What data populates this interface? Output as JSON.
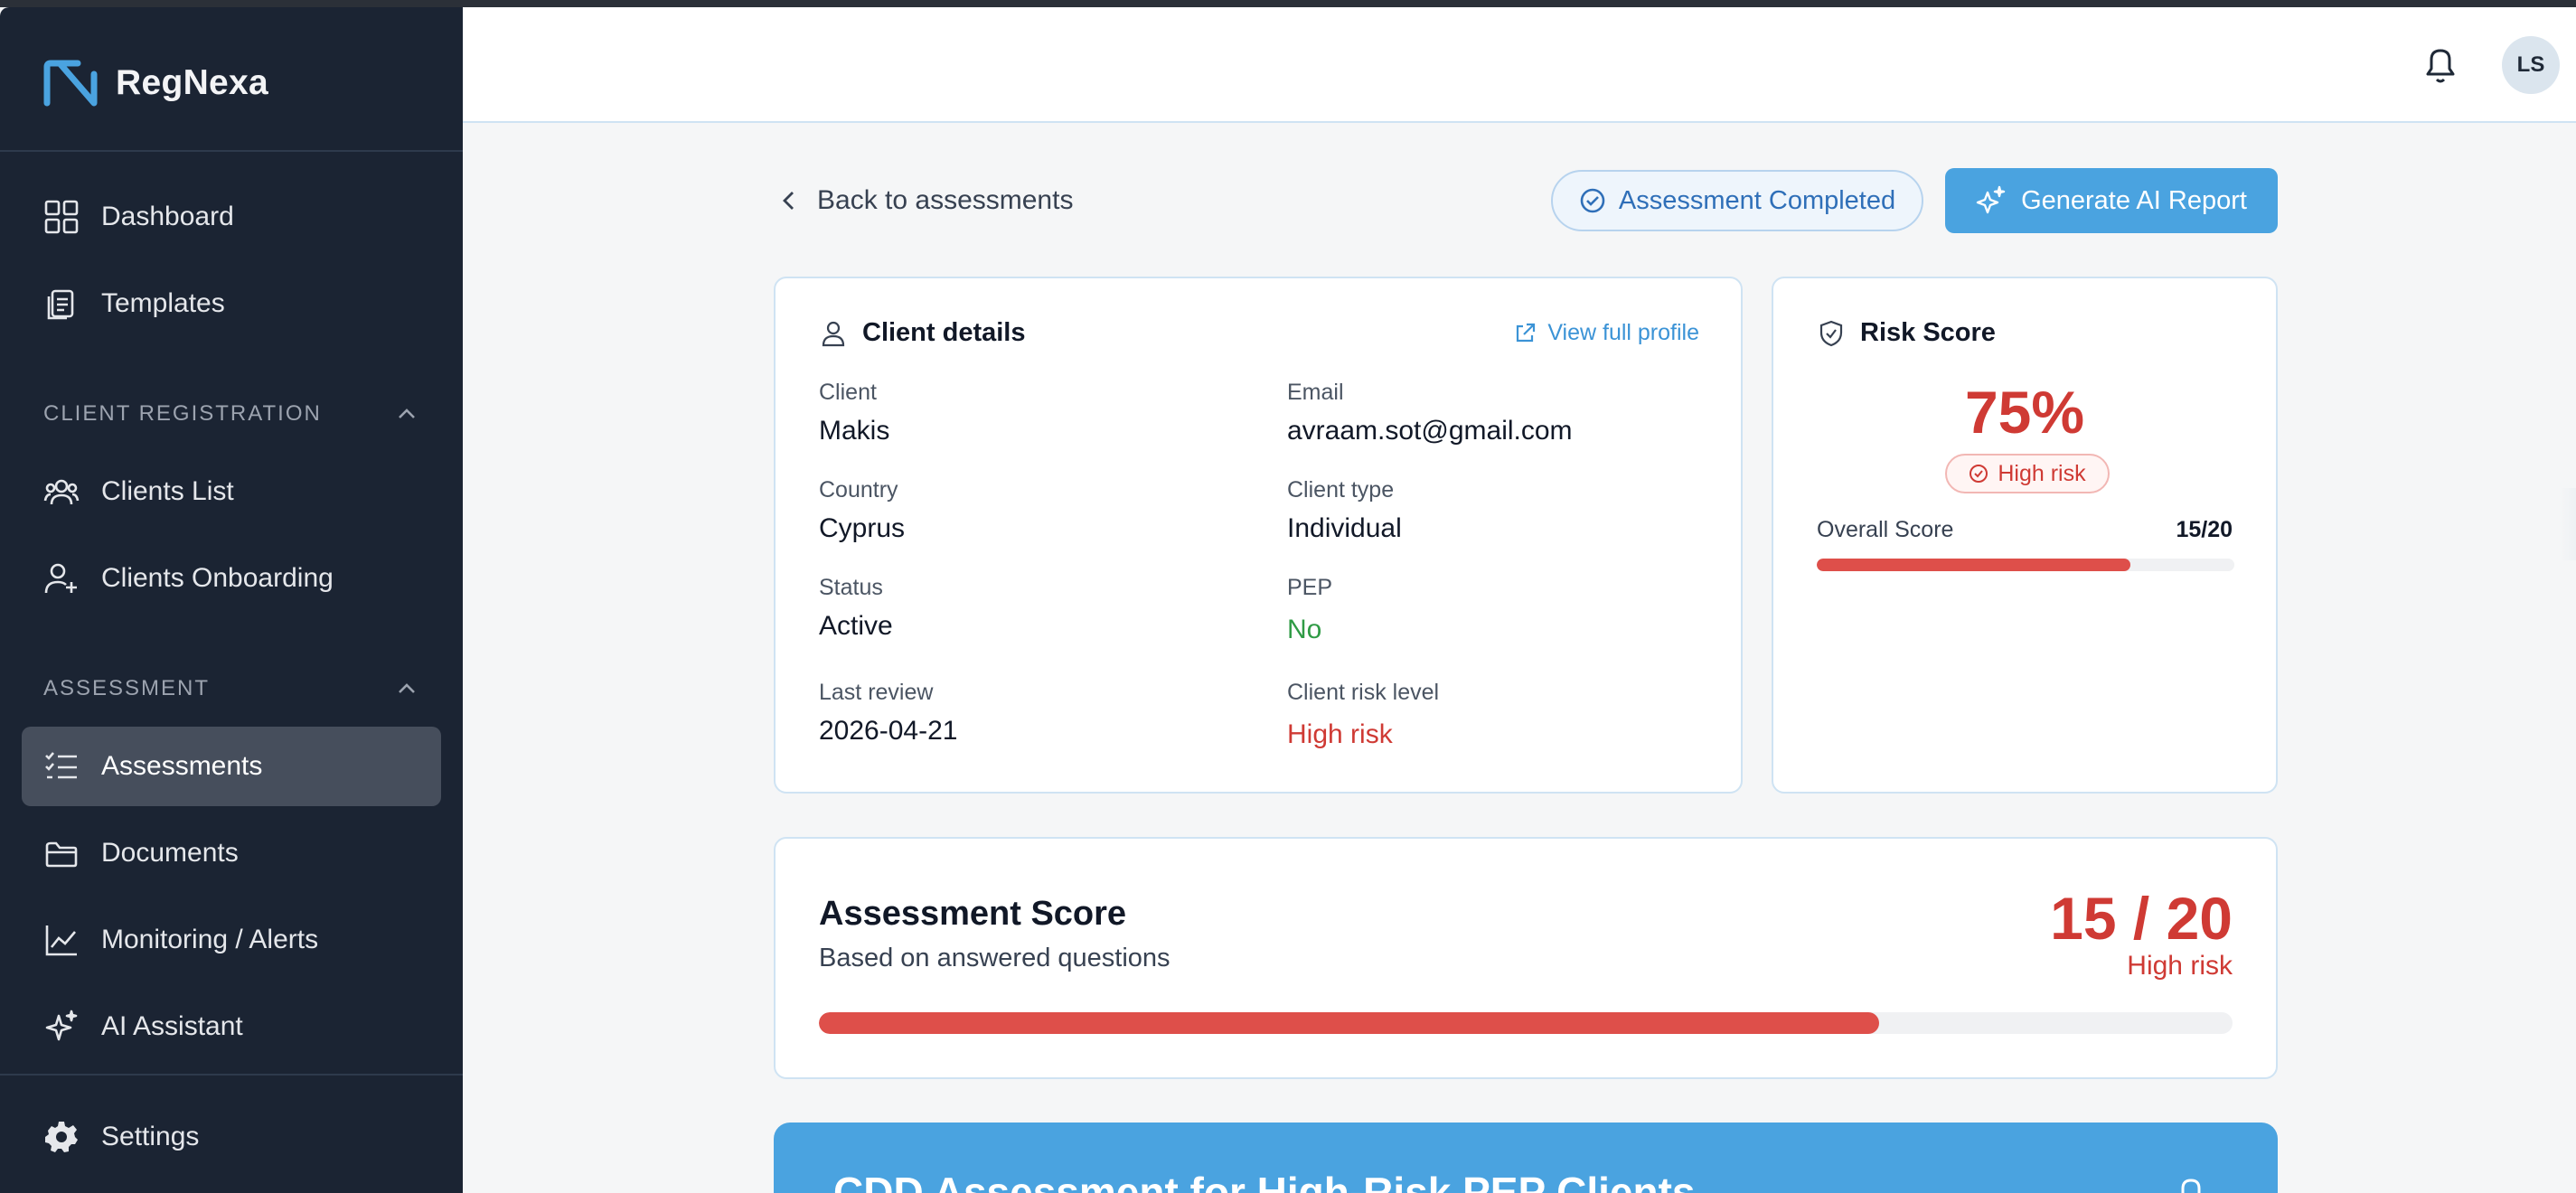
{
  "app": {
    "name": "RegNexa"
  },
  "colors": {
    "sidebar": "#1b2433",
    "accent": "#4aa3e0",
    "danger": "#cf3a34",
    "success": "#2f9b45"
  },
  "sidebar": {
    "items_top": [
      {
        "label": "Dashboard",
        "icon": "dashboard-icon"
      },
      {
        "label": "Templates",
        "icon": "templates-icon"
      }
    ],
    "section_registration": {
      "label": "CLIENT REGISTRATION",
      "items": [
        {
          "label": "Clients List",
          "icon": "clients-icon"
        },
        {
          "label": "Clients Onboarding",
          "icon": "user-plus-icon"
        }
      ]
    },
    "section_assessment": {
      "label": "ASSESSMENT",
      "items": [
        {
          "label": "Assessments",
          "icon": "checklist-icon",
          "active": true
        },
        {
          "label": "Documents",
          "icon": "folder-icon"
        },
        {
          "label": "Monitoring / Alerts",
          "icon": "chart-line-icon"
        },
        {
          "label": "AI Assistant",
          "icon": "sparkles-icon"
        }
      ]
    },
    "settings": {
      "label": "Settings",
      "icon": "gear-icon"
    }
  },
  "header": {
    "avatar_initials": "LS"
  },
  "actions": {
    "back_label": "Back to assessments",
    "status_label": "Assessment Completed",
    "ai_button_label": "Generate AI Report"
  },
  "client_details": {
    "title": "Client details",
    "view_profile_label": "View full profile",
    "fields": {
      "client": {
        "label": "Client",
        "value": "Makis"
      },
      "email": {
        "label": "Email",
        "value": "avraam.sot@gmail.com"
      },
      "country": {
        "label": "Country",
        "value": "Cyprus"
      },
      "client_type": {
        "label": "Client type",
        "value": "Individual"
      },
      "status": {
        "label": "Status",
        "value": "Active"
      },
      "pep": {
        "label": "PEP",
        "value": "No"
      },
      "last_review": {
        "label": "Last review",
        "value": "2026-04-21"
      },
      "risk_level": {
        "label": "Client risk level",
        "value": "High risk"
      }
    }
  },
  "risk_score": {
    "title": "Risk Score",
    "percent_label": "75%",
    "badge": "High risk",
    "overall_label": "Overall Score",
    "overall_value": "15/20",
    "overall_fraction": 0.75
  },
  "assessment_score": {
    "title": "Assessment Score",
    "subtitle": "Based on answered questions",
    "score": "15 / 20",
    "level": "High risk",
    "fraction": 0.75
  },
  "banner": {
    "title": "CDD Assessment for High-Risk PEP Clients"
  }
}
